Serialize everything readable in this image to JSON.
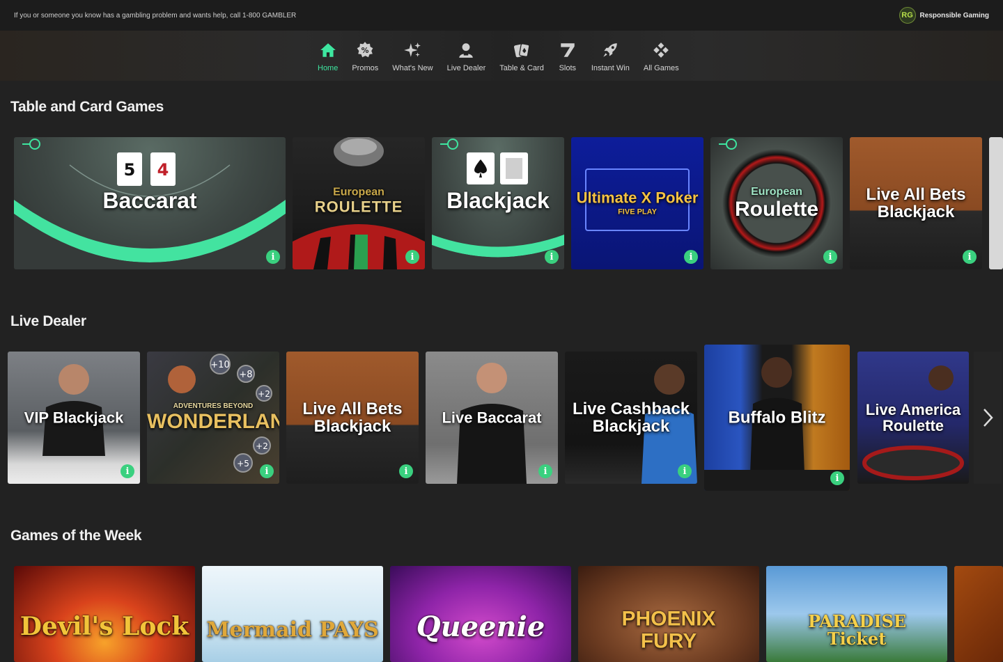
{
  "topbar": {
    "warning": "If you or someone you know has a gambling problem and wants help, call 1-800 GAMBLER",
    "rg_logo": "RG",
    "rg_label": "Responsible Gaming"
  },
  "nav": {
    "items": [
      {
        "label": "Home",
        "icon": "home-icon",
        "active": true
      },
      {
        "label": "Promos",
        "icon": "percent-icon"
      },
      {
        "label": "What's New",
        "icon": "sparkle-icon"
      },
      {
        "label": "Live Dealer",
        "icon": "dealer-icon"
      },
      {
        "label": "Table & Card",
        "icon": "cards-icon"
      },
      {
        "label": "Slots",
        "icon": "seven-icon"
      },
      {
        "label": "Instant Win",
        "icon": "rocket-icon"
      },
      {
        "label": "All Games",
        "icon": "grid-icon"
      }
    ]
  },
  "sections": {
    "table_card": {
      "title": "Table and Card Games",
      "tiles": [
        {
          "title": "Baccarat"
        },
        {
          "title_sub": "European",
          "title": "ROULETTE"
        },
        {
          "title": "Blackjack"
        },
        {
          "title": "Ultimate X Poker",
          "sub2": "FIVE PLAY"
        },
        {
          "title_sub": "European",
          "title": "Roulette"
        },
        {
          "title": "Live All Bets Blackjack"
        }
      ]
    },
    "live_dealer": {
      "title": "Live Dealer",
      "tiles": [
        {
          "title": "VIP Blackjack"
        },
        {
          "title": "WONDERLAND",
          "sub": "ADVENTURES BEYOND"
        },
        {
          "title": "Live All Bets Blackjack"
        },
        {
          "title": "Live Baccarat"
        },
        {
          "title": "Live Cashback Blackjack"
        },
        {
          "title": "Buffalo Blitz"
        },
        {
          "title": "Live America Roulette"
        }
      ]
    },
    "games_week": {
      "title": "Games of the Week",
      "tiles": [
        {
          "title": "Devil's Lock"
        },
        {
          "title": "Mermaid PAYS"
        },
        {
          "title": "Queenie"
        },
        {
          "title": "PHOENIX FURY"
        },
        {
          "title": "PARADISE Ticket"
        }
      ]
    }
  },
  "colors": {
    "accent": "#3ee6a0",
    "background": "#222222",
    "info": "#3ad07f"
  }
}
